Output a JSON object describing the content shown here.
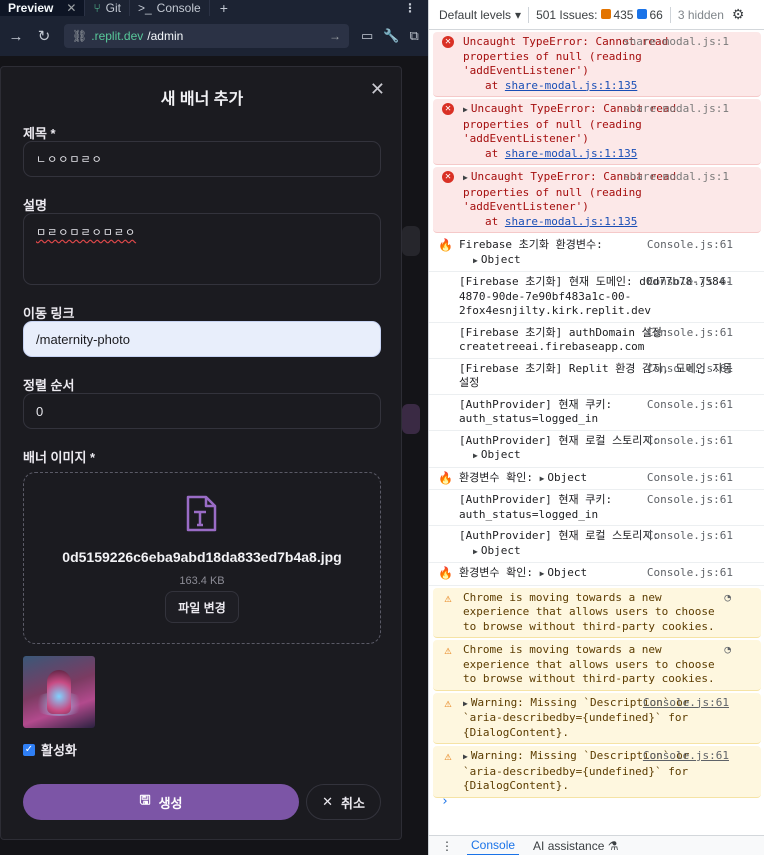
{
  "ide": {
    "tabs": [
      {
        "label": "Preview"
      },
      {
        "label": "Git"
      },
      {
        "label": "Console"
      }
    ],
    "url": {
      "domain": ".replit.dev",
      "path": "/admin"
    }
  },
  "modal": {
    "title": "새 배너 추가",
    "title_label": "제목 *",
    "title_value": "ㄴㅇㅇㅁㄹㅇ",
    "desc_label": "설명",
    "desc_value": "ㅁㄹㅇㅁㄹㅇㅁㄹㅇ",
    "link_label": "이동 링크",
    "link_value": "/maternity-photo",
    "order_label": "정렬 순서",
    "order_value": "0",
    "image_label": "배너 이미지 *",
    "file_name": "0d5159226c6eba9abd18da833ed7b4a8.jpg",
    "file_size": "163.4 KB",
    "change_file": "파일 변경",
    "active_label": "활성화",
    "active_checked": true,
    "create_button": "생성",
    "cancel_button": "취소"
  },
  "devtools": {
    "levels": "Default levels",
    "issues": "501 Issues:",
    "warn_count": "435",
    "info_count": "66",
    "hidden": "3 hidden",
    "messages": [
      {
        "type": "err",
        "text": "Uncaught TypeError: Cannot read properties of null (reading 'addEventListener')",
        "src": "share-modal.js:1",
        "at": "at ",
        "at_link": "share-modal.js:1:135",
        "expand": false
      },
      {
        "type": "err",
        "text": "Uncaught TypeError: Cannot read properties of null (reading 'addEventListener')",
        "src": "share-modal.js:1",
        "at": "at ",
        "at_link": "share-modal.js:1:135",
        "expand": true
      },
      {
        "type": "err",
        "text": "Uncaught TypeError: Cannot read properties of null (reading 'addEventListener')",
        "src": "share-modal.js:1",
        "at": "at ",
        "at_link": "share-modal.js:1:135",
        "expand": true
      },
      {
        "type": "fire",
        "text": "Firebase 초기화 환경변수:",
        "sub": "Object",
        "src": "Console.js:61"
      },
      {
        "type": "log",
        "text": "[Firebase 초기화] 현재 도메인: d0d77b78-7584-4870-90de-7e90bf483a1c-00-2fox4esnjilty.kirk.replit.dev",
        "src": "Console.js:61"
      },
      {
        "type": "log",
        "text": "[Firebase 초기화] authDomain 설정: createtreeai.firebaseapp.com",
        "src": "Console.js:61"
      },
      {
        "type": "log",
        "text": "[Firebase 초기화] Replit 환경 감지, 도메인 자동 설정",
        "src": "Console.js:61"
      },
      {
        "type": "log",
        "text": "[AuthProvider] 현재 쿠키: auth_status=logged_in",
        "src": "Console.js:61"
      },
      {
        "type": "log",
        "text": "[AuthProvider] 현재 로컬 스토리지:",
        "sub": "Object",
        "src": "Console.js:61"
      },
      {
        "type": "fire",
        "text": "환경변수 확인:",
        "inline": "Object",
        "src": "Console.js:61"
      },
      {
        "type": "log",
        "text": "[AuthProvider] 현재 쿠키: auth_status=logged_in",
        "src": "Console.js:61"
      },
      {
        "type": "log",
        "text": "[AuthProvider] 현재 로컬 스토리지:",
        "sub": "Object",
        "src": "Console.js:61"
      },
      {
        "type": "fire",
        "text": "환경변수 확인:",
        "inline": "Object",
        "src": "Console.js:61"
      },
      {
        "type": "warn",
        "text": "Chrome is moving towards a new experience that allows users to choose to browse without third-party cookies."
      },
      {
        "type": "warn",
        "text": "Chrome is moving towards a new experience that allows users to choose to browse without third-party cookies."
      },
      {
        "type": "warn",
        "text": "Warning: Missing `Description` or `aria-describedby={undefined}` for {DialogContent}.",
        "link": "Console.js:61",
        "expand": true
      },
      {
        "type": "warn",
        "text": "Warning: Missing `Description` or `aria-describedby={undefined}` for {DialogContent}.",
        "link": "Console.js:61",
        "expand": true
      }
    ],
    "drawer_tabs": [
      "Console",
      "AI assistance"
    ]
  },
  "colors": {
    "accent": "#7c55a6",
    "error": "#d93025",
    "warning": "#e37400",
    "link": "#1a73e8"
  }
}
